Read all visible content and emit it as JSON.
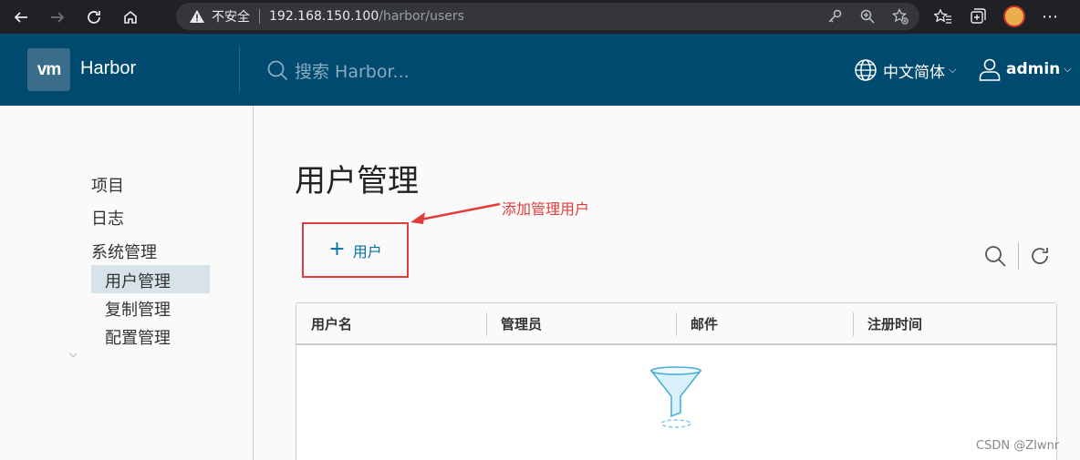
{
  "browser": {
    "security_label": "不安全",
    "url_host": "192.168.150.100",
    "url_path": "/harbor/users",
    "more": "⋯"
  },
  "header": {
    "logo_text": "vm",
    "brand": "Harbor",
    "search_placeholder": "搜索 Harbor...",
    "language": "中文简体",
    "user": "admin"
  },
  "sidebar": {
    "items": [
      {
        "label": "项目"
      },
      {
        "label": "日志"
      },
      {
        "label": "系统管理"
      },
      {
        "label": "用户管理"
      },
      {
        "label": "复制管理"
      },
      {
        "label": "配置管理"
      }
    ]
  },
  "main": {
    "title": "用户管理",
    "add_button": "用户",
    "annotation": "添加管理用户",
    "columns": [
      "用户名",
      "管理员",
      "邮件",
      "注册时间"
    ]
  },
  "watermark": "CSDN @ZIwnr",
  "colors": {
    "header_bg": "#004a70",
    "accent": "#0072a3",
    "annotation": "#e23b3b"
  }
}
